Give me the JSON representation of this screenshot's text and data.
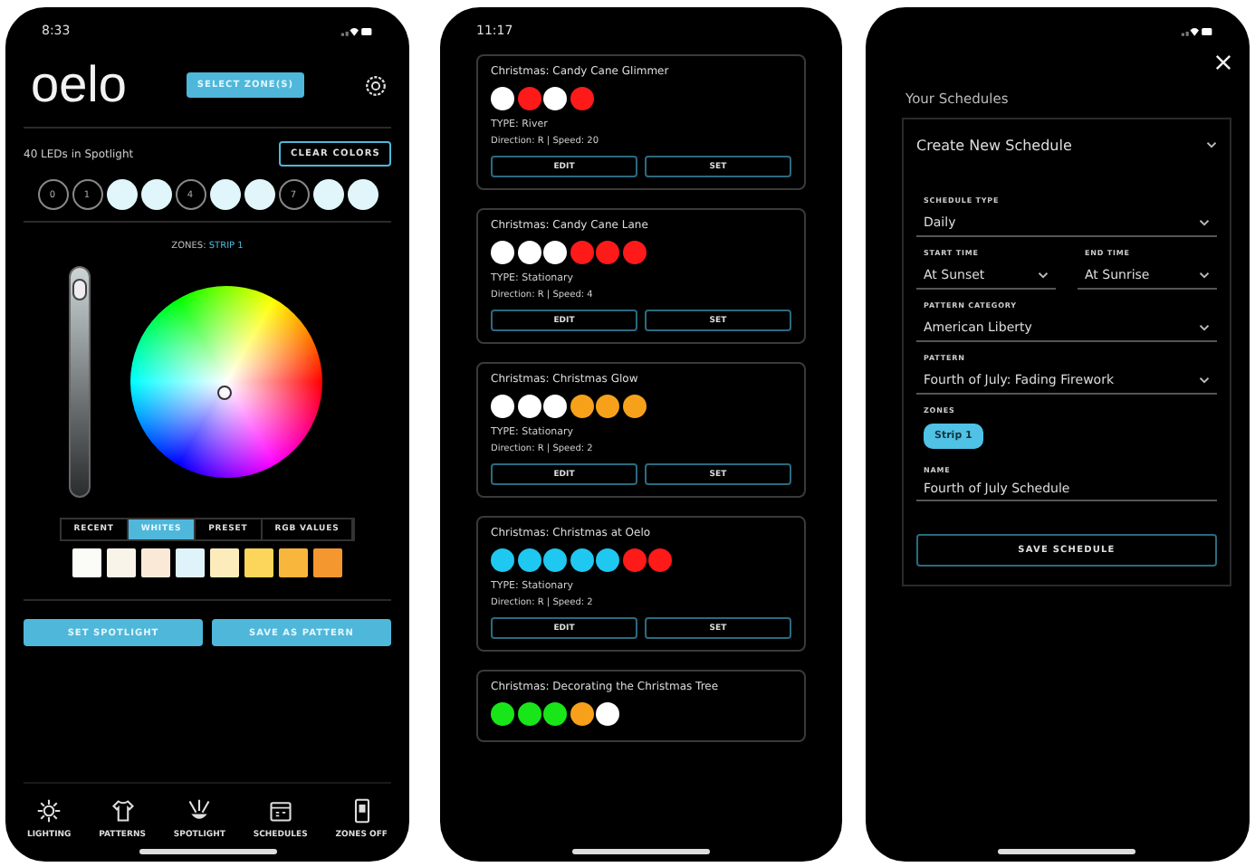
{
  "spotlight_screen": {
    "status_time": "8:33",
    "logo": "oelo",
    "select_zones_button": "SELECT ZONE(S)",
    "led_count": "40 LEDs in Spotlight",
    "clear_button": "CLEAR COLORS",
    "leds": [
      {
        "kind": "empty",
        "label": "0"
      },
      {
        "kind": "empty",
        "label": "1"
      },
      {
        "kind": "filled",
        "color": "#e0f6fa"
      },
      {
        "kind": "filled",
        "color": "#e0f6fa"
      },
      {
        "kind": "empty",
        "label": "4"
      },
      {
        "kind": "filled",
        "color": "#e0f6fa"
      },
      {
        "kind": "filled",
        "color": "#e0f6fa"
      },
      {
        "kind": "empty",
        "label": "7"
      },
      {
        "kind": "filled",
        "color": "#e0f6fa"
      },
      {
        "kind": "filled",
        "color": "#e0f6fa"
      }
    ],
    "zones_label": "ZONES:",
    "zones_value": "STRIP 1",
    "brightness": {
      "level": 0.96
    },
    "tabs": [
      {
        "label": "RECENT",
        "selected": false
      },
      {
        "label": "WHITES",
        "selected": true
      },
      {
        "label": "PRESET",
        "selected": false
      },
      {
        "label": "RGB VALUES",
        "selected": false
      }
    ],
    "swatches": [
      {
        "color": "#fbfbf8"
      },
      {
        "color": "#f8f4ea"
      },
      {
        "color": "#fbe9d8"
      },
      {
        "color": "#dff3fb"
      },
      {
        "color": "#fcecbc"
      },
      {
        "color": "#fbd65a"
      },
      {
        "color": "#f9b63c"
      },
      {
        "color": "#f5972f"
      }
    ],
    "buttons": [
      "SET SPOTLIGHT",
      "SAVE AS PATTERN"
    ],
    "nav": [
      {
        "kind": "lighting",
        "label": "LIGHTING"
      },
      {
        "kind": "patterns",
        "label": "PATTERNS"
      },
      {
        "kind": "spotlight",
        "label": "SPOTLIGHT"
      },
      {
        "kind": "schedules",
        "label": "SCHEDULES"
      },
      {
        "kind": "zones",
        "label": "ZONES OFF"
      }
    ]
  },
  "patterns_screen": {
    "status_time": "11:17",
    "cards": [
      {
        "title": "Christmas: Candy Cane Glimmer",
        "colors": [
          {
            "color": "#ffffff"
          },
          {
            "color": "#ff1a1a"
          },
          {
            "color": "#ffffff"
          },
          {
            "color": "#ff1a1a"
          }
        ],
        "type": "TYPE: River",
        "details": "Direction: R | Speed: 20",
        "buttons": [
          "EDIT",
          "SET"
        ]
      },
      {
        "title": "Christmas: Candy Cane Lane",
        "colors": [
          {
            "color": "#ffffff"
          },
          {
            "color": "#ffffff"
          },
          {
            "color": "#ffffff"
          },
          {
            "color": "#ff1a1a"
          },
          {
            "color": "#ff1a1a"
          },
          {
            "color": "#ff1a1a"
          }
        ],
        "type": "TYPE: Stationary",
        "details": "Direction: R | Speed: 4",
        "buttons": [
          "EDIT",
          "SET"
        ]
      },
      {
        "title": "Christmas: Christmas Glow",
        "colors": [
          {
            "color": "#ffffff"
          },
          {
            "color": "#ffffff"
          },
          {
            "color": "#ffffff"
          },
          {
            "color": "#f7a11a"
          },
          {
            "color": "#f7a11a"
          },
          {
            "color": "#f7a11a"
          }
        ],
        "type": "TYPE: Stationary",
        "details": "Direction: R | Speed: 2",
        "buttons": [
          "EDIT",
          "SET"
        ]
      },
      {
        "title": "Christmas: Christmas at Oelo",
        "colors": [
          {
            "color": "#1ec8f0"
          },
          {
            "color": "#1ec8f0"
          },
          {
            "color": "#1ec8f0"
          },
          {
            "color": "#1ec8f0"
          },
          {
            "color": "#1ec8f0"
          },
          {
            "color": "#ff1a1a"
          },
          {
            "color": "#ff1a1a"
          }
        ],
        "type": "TYPE: Stationary",
        "details": "Direction: R | Speed: 2",
        "buttons": [
          "EDIT",
          "SET"
        ]
      },
      {
        "title": "Christmas: Decorating the Christmas Tree",
        "colors": [
          {
            "color": "#19e619"
          },
          {
            "color": "#19e619"
          },
          {
            "color": "#19e619"
          },
          {
            "color": "#f7a11a"
          },
          {
            "color": "#ffffff"
          }
        ]
      }
    ]
  },
  "schedule_screen": {
    "title": "Your Schedules",
    "panel_title": "Create New Schedule",
    "schedule_type": {
      "label": "SCHEDULE TYPE",
      "value": "Daily"
    },
    "start_time": {
      "label": "START TIME",
      "value": "At Sunset"
    },
    "end_time": {
      "label": "END TIME",
      "value": "At Sunrise"
    },
    "pattern_category": {
      "label": "PATTERN CATEGORY",
      "value": "American Liberty"
    },
    "pattern": {
      "label": "PATTERN",
      "value": "Fourth of July: Fading Firework"
    },
    "zones_label": "ZONES",
    "zones": [
      {
        "label": "Strip 1",
        "selected": true
      }
    ],
    "name": {
      "label": "NAME",
      "value": "Fourth of July Schedule"
    },
    "save_button": "SAVE SCHEDULE"
  }
}
